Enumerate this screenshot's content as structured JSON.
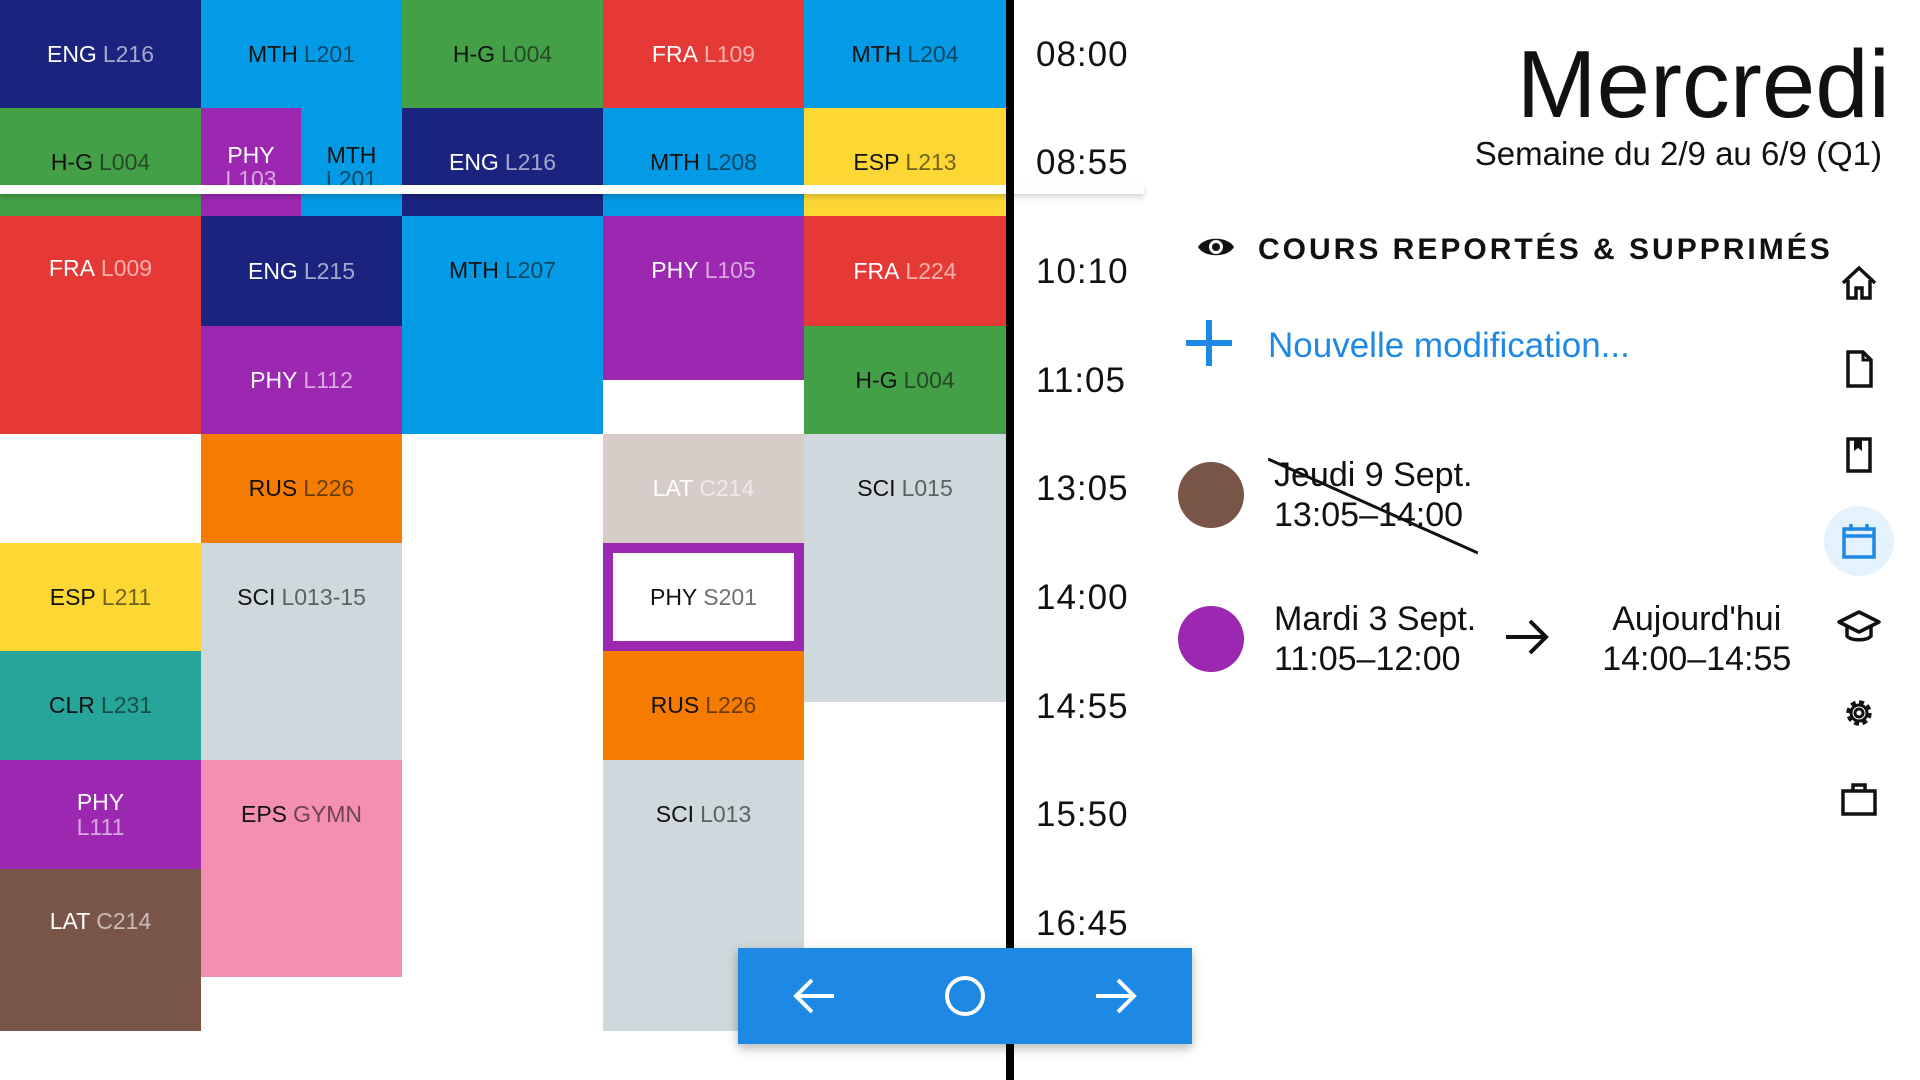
{
  "schedule": {
    "times": [
      "08:00",
      "08:55",
      "10:10",
      "11:05",
      "13:05",
      "14:00",
      "14:55",
      "15:50",
      "16:45"
    ],
    "cells": [
      {
        "subject": "ENG",
        "room": "L216",
        "bg": "#1a237e",
        "fg": "#ffffff"
      },
      {
        "subject": "H-G",
        "room": "L004",
        "bg": "#43a047",
        "fg": "#111111"
      },
      {
        "subject": "FRA",
        "room": "L009",
        "bg": "#e53935",
        "fg": "#ffffff"
      },
      {
        "subject": "ESP",
        "room": "L211",
        "bg": "#fdd835",
        "fg": "#111111"
      },
      {
        "subject": "CLR",
        "room": "L231",
        "bg": "#26a69a",
        "fg": "#111111"
      },
      {
        "subject": "PHY",
        "room": "L111",
        "bg": "#9c27b0",
        "fg": "#ffffff"
      },
      {
        "subject": "LAT",
        "room": "C214",
        "bg": "#795548",
        "fg": "#ffffff"
      },
      {
        "subject": "MTH",
        "room": "L201",
        "bg": "#039be5",
        "fg": "#111111"
      },
      {
        "subject": "PHY",
        "room": "L103",
        "bg": "#9c27b0",
        "fg": "#ffffff"
      },
      {
        "subject": "MTH",
        "room": "L201",
        "bg": "#039be5",
        "fg": "#111111"
      },
      {
        "subject": "ENG",
        "room": "L215",
        "bg": "#1a237e",
        "fg": "#ffffff"
      },
      {
        "subject": "PHY",
        "room": "L112",
        "bg": "#9c27b0",
        "fg": "#ffffff"
      },
      {
        "subject": "RUS",
        "room": "L226",
        "bg": "#f57c00",
        "fg": "#111111"
      },
      {
        "subject": "SCI",
        "room": "L013-15",
        "bg": "#cfd8dc",
        "fg": "#111111"
      },
      {
        "subject": "EPS",
        "room": "GYMN",
        "bg": "#f48fb1",
        "fg": "#111111"
      },
      {
        "subject": "H-G",
        "room": "L004",
        "bg": "#43a047",
        "fg": "#111111"
      },
      {
        "subject": "ENG",
        "room": "L216",
        "bg": "#1a237e",
        "fg": "#ffffff"
      },
      {
        "subject": "MTH",
        "room": "L207",
        "bg": "#039be5",
        "fg": "#111111"
      },
      {
        "subject": "FRA",
        "room": "L109",
        "bg": "#e53935",
        "fg": "#ffffff"
      },
      {
        "subject": "MTH",
        "room": "L208",
        "bg": "#039be5",
        "fg": "#111111"
      },
      {
        "subject": "PHY",
        "room": "L105",
        "bg": "#9c27b0",
        "fg": "#ffffff"
      },
      {
        "subject": "LAT",
        "room": "C214",
        "bg": "#d7ccc8",
        "fg": "#ffffff"
      },
      {
        "subject": "PHY",
        "room": "S201",
        "bg": "#ffffff",
        "fg": "#111111"
      },
      {
        "subject": "RUS",
        "room": "L226",
        "bg": "#f57c00",
        "fg": "#111111"
      },
      {
        "subject": "SCI",
        "room": "L013",
        "bg": "#cfd8dc",
        "fg": "#111111"
      },
      {
        "subject": "MTH",
        "room": "L204",
        "bg": "#039be5",
        "fg": "#111111"
      },
      {
        "subject": "ESP",
        "room": "L213",
        "bg": "#fdd835",
        "fg": "#111111"
      },
      {
        "subject": "FRA",
        "room": "L224",
        "bg": "#e53935",
        "fg": "#ffffff"
      },
      {
        "subject": "H-G",
        "room": "L004",
        "bg": "#43a047",
        "fg": "#111111"
      },
      {
        "subject": "SCI",
        "room": "L015",
        "bg": "#cfd8dc",
        "fg": "#111111"
      }
    ]
  },
  "header": {
    "day": "Mercredi",
    "week": "Semaine du  2/9 au 6/9 (Q1)"
  },
  "changes": {
    "section_title": "COURS REPORTÉS & SUPPRIMÉS",
    "new_label": "Nouvelle modification...",
    "items": [
      {
        "color": "#795548",
        "line1": "Jeudi 9 Sept.",
        "line2": "13:05–14:00",
        "cancelled": true
      },
      {
        "color": "#9c27b0",
        "line1": "Mardi 3 Sept.",
        "line2": "11:05–12:00",
        "to_line1": "Aujourd'hui",
        "to_line2": "14:00–14:55"
      }
    ]
  },
  "rail": {
    "icons": [
      "home-icon",
      "document-icon",
      "book-icon",
      "calendar-icon",
      "graduation-cap-icon",
      "settings-icon",
      "briefcase-icon"
    ],
    "active": "calendar-icon"
  },
  "nav": {
    "icons": [
      "arrow-left-icon",
      "circle-icon",
      "arrow-right-icon"
    ]
  },
  "colors": {
    "accent": "#1e88e5",
    "active_rail_bg": "#e3f2fd",
    "outline_purple": "#9c27b0"
  }
}
